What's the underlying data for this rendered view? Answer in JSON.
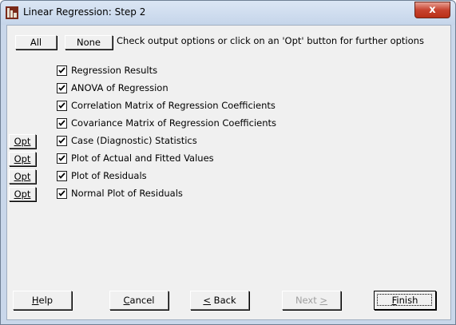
{
  "window": {
    "title": "Linear Regression: Step 2",
    "close_glyph": "x"
  },
  "top": {
    "all_label": "All",
    "none_label": "None",
    "hint": "Check output options or click on an 'Opt' button for further options"
  },
  "options": [
    {
      "label": "Regression Results",
      "checked": true,
      "opt": false
    },
    {
      "label": "ANOVA of Regression",
      "checked": true,
      "opt": false
    },
    {
      "label": "Correlation Matrix of Regression Coefficients",
      "checked": true,
      "opt": false
    },
    {
      "label": "Covariance Matrix of Regression Coefficients",
      "checked": true,
      "opt": false
    },
    {
      "label": "Case (Diagnostic) Statistics",
      "checked": true,
      "opt": true
    },
    {
      "label": "Plot of Actual and Fitted Values",
      "checked": true,
      "opt": true
    },
    {
      "label": "Plot of Residuals",
      "checked": true,
      "opt": true
    },
    {
      "label": "Normal Plot of Residuals",
      "checked": true,
      "opt": true
    }
  ],
  "opt_label": "Opt",
  "footer": {
    "help": {
      "mnemonic": "H",
      "rest": "elp"
    },
    "cancel": {
      "mnemonic": "C",
      "rest": "ancel"
    },
    "back": {
      "mnemonic": "<",
      "rest": " Back"
    },
    "next": {
      "pre": "Next ",
      "mnemonic": ">"
    },
    "finish": {
      "mnemonic": "F",
      "rest": "inish"
    }
  },
  "colors": {
    "titlebar": "#c5d5ea",
    "client_bg": "#f0f0f0",
    "close_red": "#c7432f"
  }
}
